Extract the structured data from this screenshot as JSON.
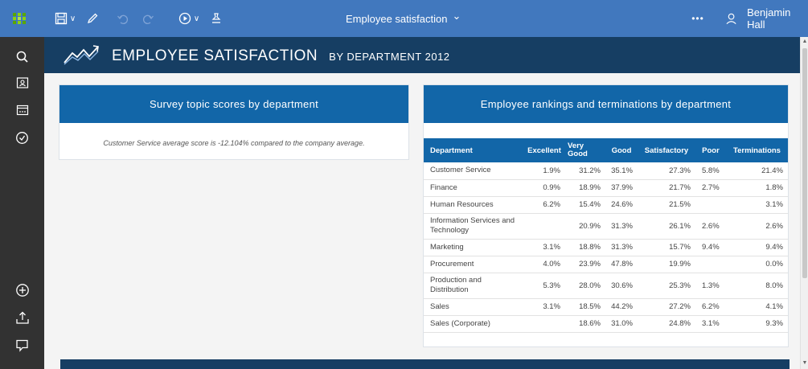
{
  "toolbar": {
    "title": "Employee satisfaction",
    "user_name": "Benjamin Hall",
    "overflow": "•••",
    "dropdown_chevron": "⌄"
  },
  "report": {
    "title": "EMPLOYEE SATISFACTION",
    "subtitle": "BY DEPARTMENT 2012"
  },
  "survey_panel": {
    "header": "Survey topic scores by department",
    "note": "Customer Service average score is -12.104% compared to the company average."
  },
  "rankings_panel": {
    "header": "Employee rankings and terminations by department",
    "columns": [
      "Department",
      "Excellent",
      "Very Good",
      "Good",
      "Satisfactory",
      "Poor",
      "Terminations"
    ],
    "rows": [
      [
        "Customer Service",
        "1.9%",
        "31.2%",
        "35.1%",
        "27.3%",
        "5.8%",
        "21.4%"
      ],
      [
        "Finance",
        "0.9%",
        "18.9%",
        "37.9%",
        "21.7%",
        "2.7%",
        "1.8%"
      ],
      [
        "Human Resources",
        "6.2%",
        "15.4%",
        "24.6%",
        "21.5%",
        "",
        "3.1%"
      ],
      [
        "Information Services and Technology",
        "",
        "20.9%",
        "31.3%",
        "26.1%",
        "2.6%",
        "2.6%"
      ],
      [
        "Marketing",
        "3.1%",
        "18.8%",
        "31.3%",
        "15.7%",
        "9.4%",
        "9.4%"
      ],
      [
        "Procurement",
        "4.0%",
        "23.9%",
        "47.8%",
        "19.9%",
        "",
        "0.0%"
      ],
      [
        "Production and Distribution",
        "5.3%",
        "28.0%",
        "30.6%",
        "25.3%",
        "1.3%",
        "8.0%"
      ],
      [
        "Sales",
        "3.1%",
        "18.5%",
        "44.2%",
        "27.2%",
        "6.2%",
        "4.1%"
      ],
      [
        "Sales (Corporate)",
        "",
        "18.6%",
        "31.0%",
        "24.8%",
        "3.1%",
        "9.3%"
      ]
    ]
  },
  "colors": {
    "toolbar": "#4178be",
    "left_nav": "#323232",
    "banner": "#163e63",
    "panel_header": "#1266a8"
  },
  "icons": {
    "toolbar": [
      "app-grid-icon",
      "save-icon",
      "edit-icon",
      "undo-icon",
      "redo-icon",
      "play-icon",
      "pin-icon",
      "more-icon",
      "user-icon"
    ],
    "left_nav": [
      "search-icon",
      "my-content-icon",
      "team-content-icon",
      "recent-icon",
      "new-icon",
      "upload-icon",
      "comment-icon"
    ]
  }
}
